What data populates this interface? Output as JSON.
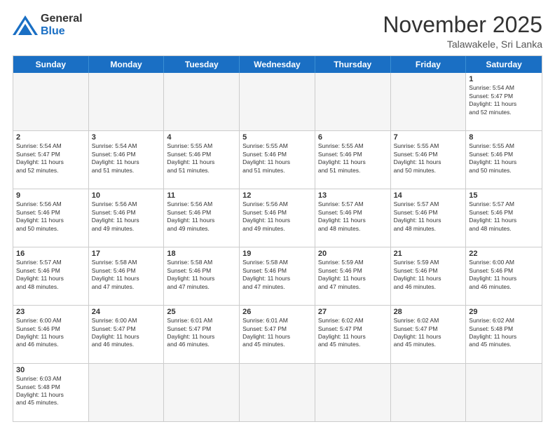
{
  "logo": {
    "general": "General",
    "blue": "Blue"
  },
  "title": "November 2025",
  "location": "Talawakele, Sri Lanka",
  "header_days": [
    "Sunday",
    "Monday",
    "Tuesday",
    "Wednesday",
    "Thursday",
    "Friday",
    "Saturday"
  ],
  "weeks": [
    [
      {
        "day": "",
        "info": "",
        "empty": true
      },
      {
        "day": "",
        "info": "",
        "empty": true
      },
      {
        "day": "",
        "info": "",
        "empty": true
      },
      {
        "day": "",
        "info": "",
        "empty": true
      },
      {
        "day": "",
        "info": "",
        "empty": true
      },
      {
        "day": "",
        "info": "",
        "empty": true
      },
      {
        "day": "1",
        "info": "Sunrise: 5:54 AM\nSunset: 5:47 PM\nDaylight: 11 hours\nand 52 minutes."
      }
    ],
    [
      {
        "day": "2",
        "info": "Sunrise: 5:54 AM\nSunset: 5:47 PM\nDaylight: 11 hours\nand 52 minutes."
      },
      {
        "day": "3",
        "info": "Sunrise: 5:54 AM\nSunset: 5:46 PM\nDaylight: 11 hours\nand 51 minutes."
      },
      {
        "day": "4",
        "info": "Sunrise: 5:55 AM\nSunset: 5:46 PM\nDaylight: 11 hours\nand 51 minutes."
      },
      {
        "day": "5",
        "info": "Sunrise: 5:55 AM\nSunset: 5:46 PM\nDaylight: 11 hours\nand 51 minutes."
      },
      {
        "day": "6",
        "info": "Sunrise: 5:55 AM\nSunset: 5:46 PM\nDaylight: 11 hours\nand 51 minutes."
      },
      {
        "day": "7",
        "info": "Sunrise: 5:55 AM\nSunset: 5:46 PM\nDaylight: 11 hours\nand 50 minutes."
      },
      {
        "day": "8",
        "info": "Sunrise: 5:55 AM\nSunset: 5:46 PM\nDaylight: 11 hours\nand 50 minutes."
      }
    ],
    [
      {
        "day": "9",
        "info": "Sunrise: 5:56 AM\nSunset: 5:46 PM\nDaylight: 11 hours\nand 50 minutes."
      },
      {
        "day": "10",
        "info": "Sunrise: 5:56 AM\nSunset: 5:46 PM\nDaylight: 11 hours\nand 49 minutes."
      },
      {
        "day": "11",
        "info": "Sunrise: 5:56 AM\nSunset: 5:46 PM\nDaylight: 11 hours\nand 49 minutes."
      },
      {
        "day": "12",
        "info": "Sunrise: 5:56 AM\nSunset: 5:46 PM\nDaylight: 11 hours\nand 49 minutes."
      },
      {
        "day": "13",
        "info": "Sunrise: 5:57 AM\nSunset: 5:46 PM\nDaylight: 11 hours\nand 48 minutes."
      },
      {
        "day": "14",
        "info": "Sunrise: 5:57 AM\nSunset: 5:46 PM\nDaylight: 11 hours\nand 48 minutes."
      },
      {
        "day": "15",
        "info": "Sunrise: 5:57 AM\nSunset: 5:46 PM\nDaylight: 11 hours\nand 48 minutes."
      }
    ],
    [
      {
        "day": "16",
        "info": "Sunrise: 5:57 AM\nSunset: 5:46 PM\nDaylight: 11 hours\nand 48 minutes."
      },
      {
        "day": "17",
        "info": "Sunrise: 5:58 AM\nSunset: 5:46 PM\nDaylight: 11 hours\nand 47 minutes."
      },
      {
        "day": "18",
        "info": "Sunrise: 5:58 AM\nSunset: 5:46 PM\nDaylight: 11 hours\nand 47 minutes."
      },
      {
        "day": "19",
        "info": "Sunrise: 5:58 AM\nSunset: 5:46 PM\nDaylight: 11 hours\nand 47 minutes."
      },
      {
        "day": "20",
        "info": "Sunrise: 5:59 AM\nSunset: 5:46 PM\nDaylight: 11 hours\nand 47 minutes."
      },
      {
        "day": "21",
        "info": "Sunrise: 5:59 AM\nSunset: 5:46 PM\nDaylight: 11 hours\nand 46 minutes."
      },
      {
        "day": "22",
        "info": "Sunrise: 6:00 AM\nSunset: 5:46 PM\nDaylight: 11 hours\nand 46 minutes."
      }
    ],
    [
      {
        "day": "23",
        "info": "Sunrise: 6:00 AM\nSunset: 5:46 PM\nDaylight: 11 hours\nand 46 minutes."
      },
      {
        "day": "24",
        "info": "Sunrise: 6:00 AM\nSunset: 5:47 PM\nDaylight: 11 hours\nand 46 minutes."
      },
      {
        "day": "25",
        "info": "Sunrise: 6:01 AM\nSunset: 5:47 PM\nDaylight: 11 hours\nand 46 minutes."
      },
      {
        "day": "26",
        "info": "Sunrise: 6:01 AM\nSunset: 5:47 PM\nDaylight: 11 hours\nand 45 minutes."
      },
      {
        "day": "27",
        "info": "Sunrise: 6:02 AM\nSunset: 5:47 PM\nDaylight: 11 hours\nand 45 minutes."
      },
      {
        "day": "28",
        "info": "Sunrise: 6:02 AM\nSunset: 5:47 PM\nDaylight: 11 hours\nand 45 minutes."
      },
      {
        "day": "29",
        "info": "Sunrise: 6:02 AM\nSunset: 5:48 PM\nDaylight: 11 hours\nand 45 minutes."
      }
    ],
    [
      {
        "day": "30",
        "info": "Sunrise: 6:03 AM\nSunset: 5:48 PM\nDaylight: 11 hours\nand 45 minutes."
      },
      {
        "day": "",
        "info": "",
        "empty": true
      },
      {
        "day": "",
        "info": "",
        "empty": true
      },
      {
        "day": "",
        "info": "",
        "empty": true
      },
      {
        "day": "",
        "info": "",
        "empty": true
      },
      {
        "day": "",
        "info": "",
        "empty": true
      },
      {
        "day": "",
        "info": "",
        "empty": true
      }
    ]
  ]
}
